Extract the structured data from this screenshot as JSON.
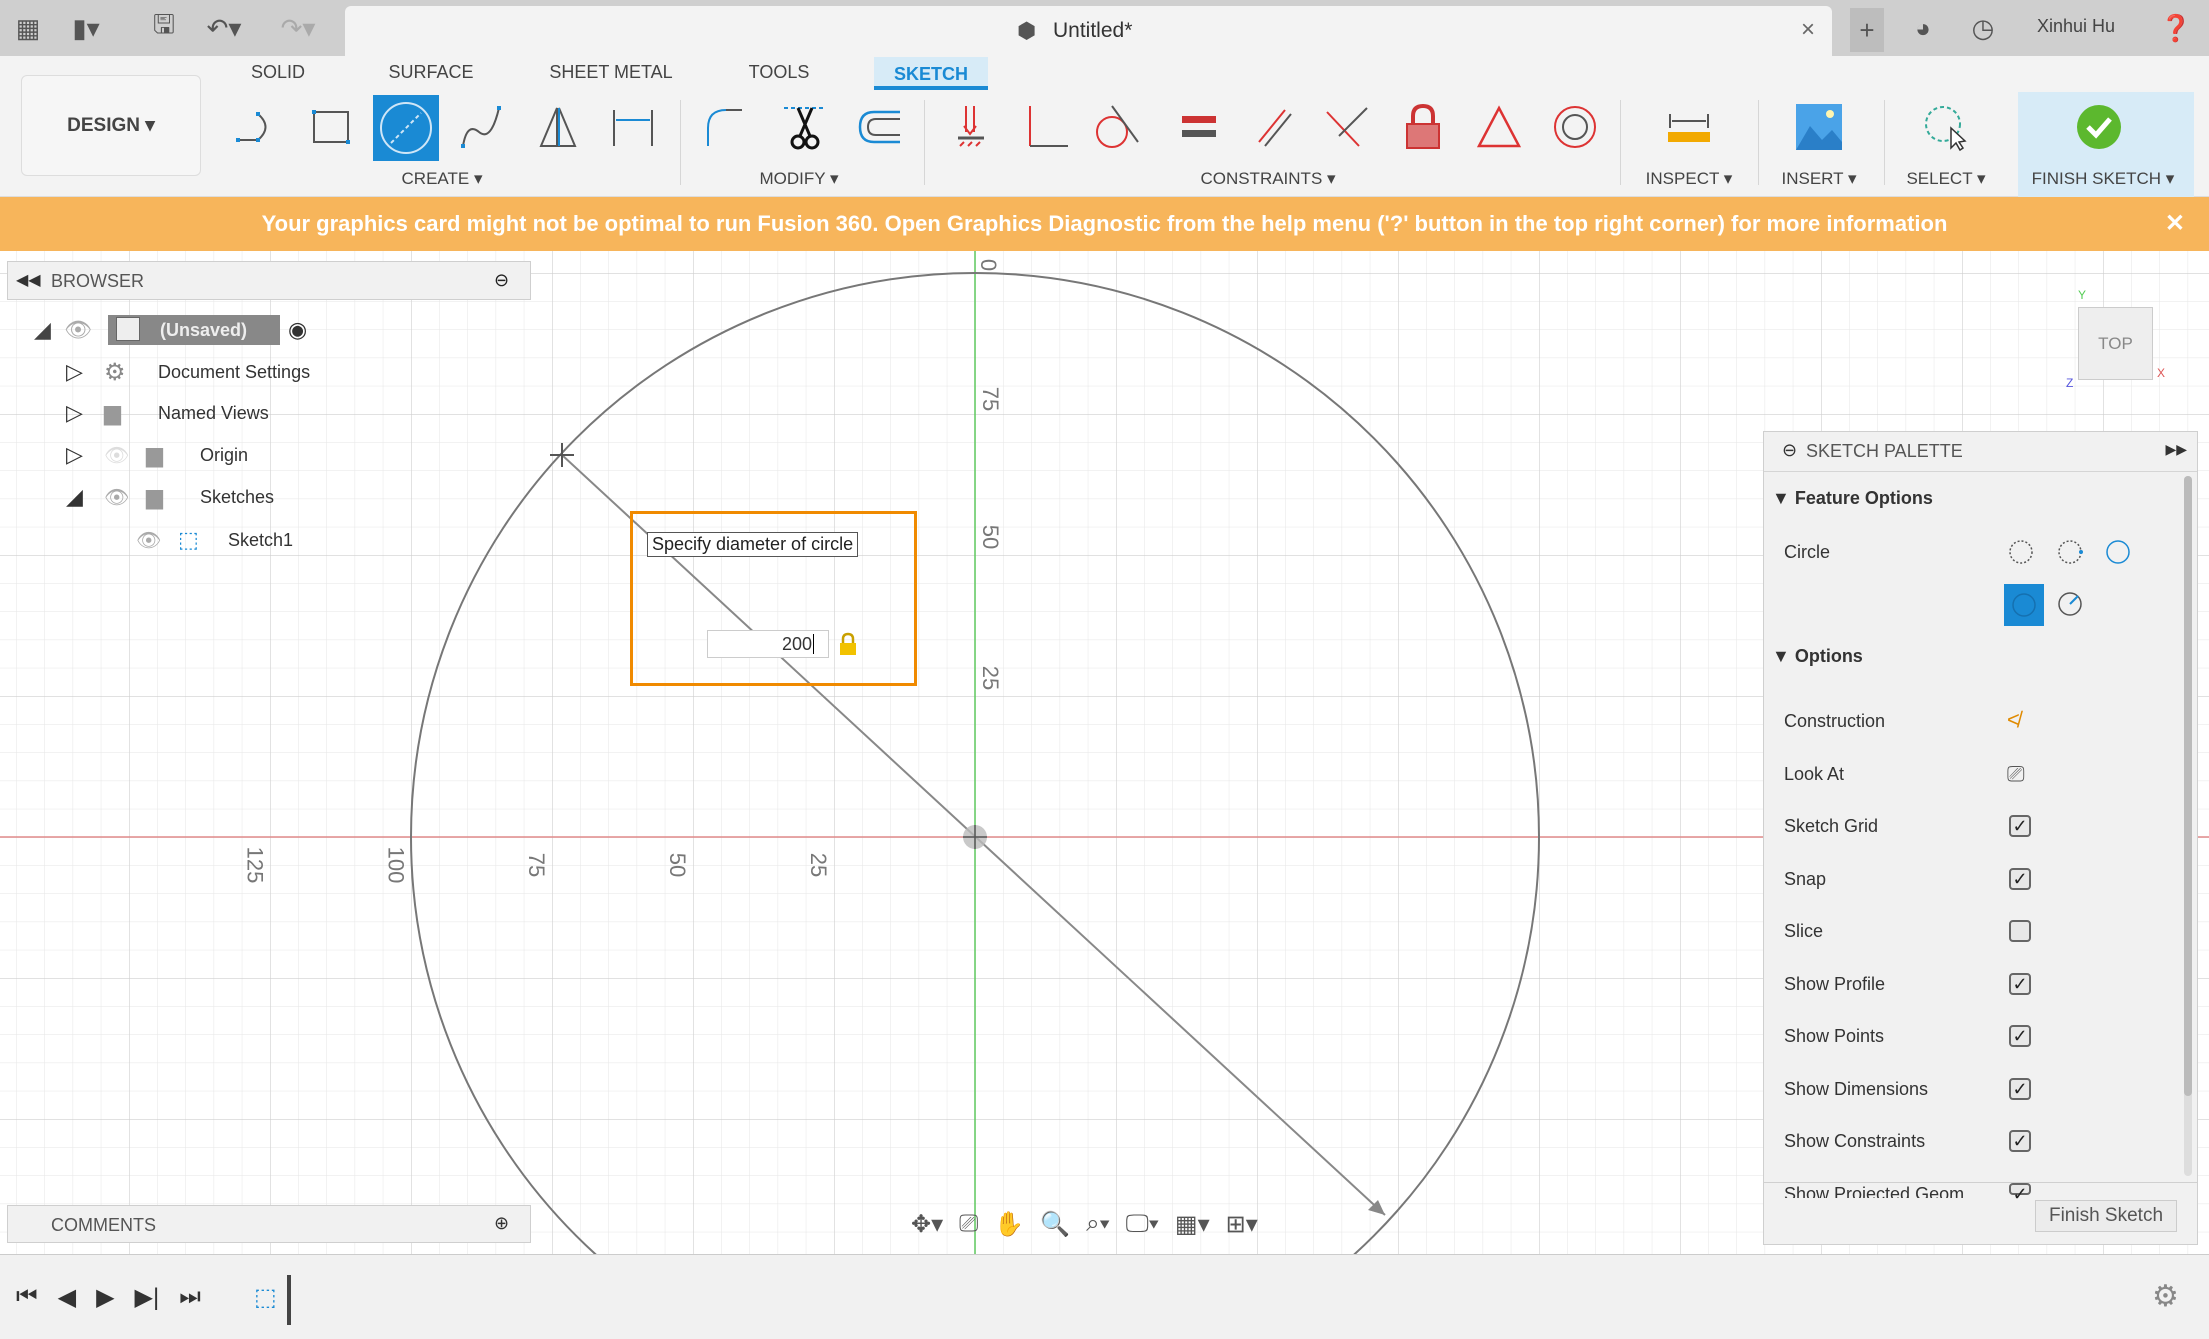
{
  "titlebar": {
    "doc_title": "Untitled*",
    "user": "Xinhui Hu",
    "icons": [
      "grid-menu-icon",
      "file-icon",
      "save-icon",
      "undo-icon",
      "redo-icon",
      "close-icon",
      "plus-icon",
      "extensions-icon",
      "job-status-icon",
      "help-icon"
    ]
  },
  "ribbon": {
    "workspace": "DESIGN ▾",
    "tabs": [
      "SOLID",
      "SURFACE",
      "SHEET METAL",
      "TOOLS",
      "SKETCH"
    ],
    "active_tab": "SKETCH",
    "groups": {
      "create": "CREATE ▾",
      "modify": "MODIFY ▾",
      "constraints": "CONSTRAINTS ▾",
      "inspect": "INSPECT ▾",
      "insert": "INSERT ▾",
      "select": "SELECT ▾",
      "finish": "FINISH SKETCH ▾"
    }
  },
  "banner": {
    "text": "Your graphics card might not be optimal to run Fusion 360. Open Graphics Diagnostic from the help menu ('?' button in the top right corner) for more information",
    "close": "✕"
  },
  "browser": {
    "title": "BROWSER",
    "items": [
      {
        "label": "(Unsaved)"
      },
      {
        "label": "Document Settings"
      },
      {
        "label": "Named Views"
      },
      {
        "label": "Origin"
      },
      {
        "label": "Sketches"
      },
      {
        "label": "Sketch1"
      }
    ]
  },
  "comments": {
    "title": "COMMENTS"
  },
  "canvas": {
    "tooltip": "Specify diameter of circle",
    "diameter_value": "200",
    "axis_labels_vertical": [
      "0",
      "75",
      "50",
      "25"
    ],
    "axis_labels_horizontal": [
      "125",
      "100",
      "75",
      "50",
      "25"
    ],
    "viewcube": "TOP",
    "accent": "#f08a00"
  },
  "palette": {
    "title": "SKETCH PALETTE",
    "feature_options": "Feature Options",
    "circle_label": "Circle",
    "options": "Options",
    "rows": [
      {
        "label": "Construction"
      },
      {
        "label": "Look At"
      },
      {
        "label": "Sketch Grid",
        "checked": true
      },
      {
        "label": "Snap",
        "checked": true
      },
      {
        "label": "Slice",
        "checked": false
      },
      {
        "label": "Show Profile",
        "checked": true
      },
      {
        "label": "Show Points",
        "checked": true
      },
      {
        "label": "Show Dimensions",
        "checked": true
      },
      {
        "label": "Show Constraints",
        "checked": true
      },
      {
        "label": "Show Projected Geom...",
        "checked": true
      }
    ],
    "finish_button": "Finish Sketch"
  }
}
